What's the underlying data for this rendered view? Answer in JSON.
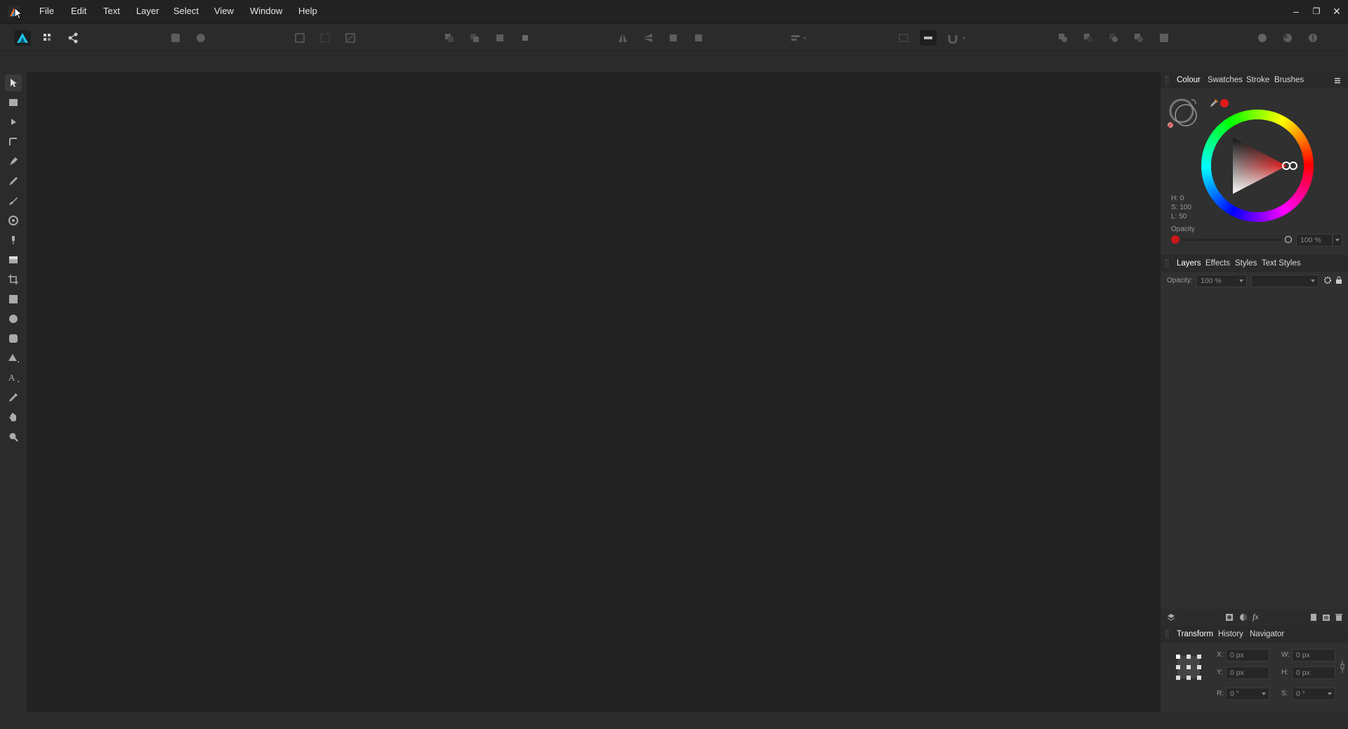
{
  "menu": {
    "items": [
      "File",
      "Edit",
      "Text",
      "Layer",
      "Select",
      "View",
      "Window",
      "Help"
    ]
  },
  "window_controls": {
    "minimize": "–",
    "restore": "❐",
    "close": "✕"
  },
  "colour_panel": {
    "tabs": [
      "Colour",
      "Swatches",
      "Stroke",
      "Brushes"
    ],
    "h_label": "H: 0",
    "s_label": "S: 100",
    "l_label": "L: 50",
    "opacity_label": "Opacity",
    "opacity_value": "100 %",
    "opacity_level": 1.0,
    "current_color": "#e01b1b"
  },
  "layers_panel": {
    "tabs": [
      "Layers",
      "Effects",
      "Styles",
      "Text Styles"
    ],
    "opacity_label": "Opacity:",
    "opacity_value": "100 %",
    "blend_mode": ""
  },
  "transform_panel": {
    "tabs": [
      "Transform",
      "History",
      "Navigator"
    ],
    "x_label": "X:",
    "x_value": "0 px",
    "y_label": "Y:",
    "y_value": "0 px",
    "w_label": "W:",
    "w_value": "0 px",
    "h_label": "H:",
    "h_value": "0 px",
    "r_label": "R:",
    "r_value": "0 °",
    "s_label": "S:",
    "s_value": "0 °"
  },
  "colors": {
    "accent_blue": "#1ec3e8",
    "hue_red": "#e01b1b"
  }
}
